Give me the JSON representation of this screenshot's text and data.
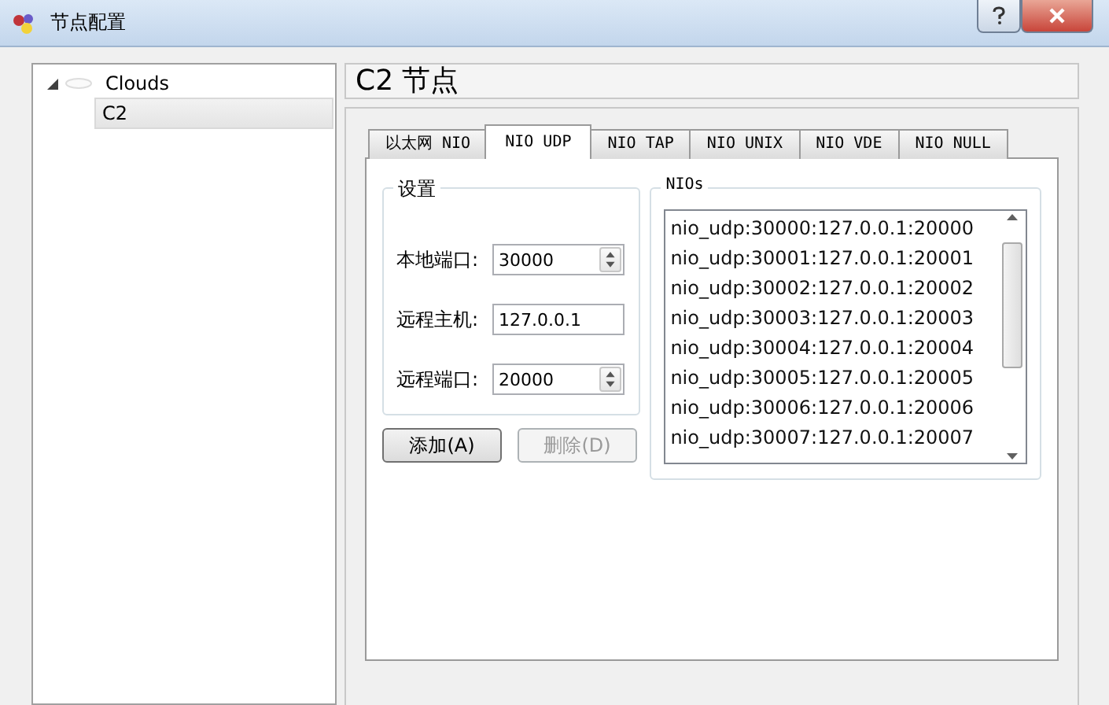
{
  "window": {
    "title": "节点配置"
  },
  "tree": [
    {
      "label": "Clouds",
      "expanded": true,
      "selected": false,
      "children": [
        {
          "label": "C2",
          "selected": true
        }
      ]
    }
  ],
  "header": "C2 节点",
  "tabs": [
    {
      "label": "以太网 NIO",
      "selected": false
    },
    {
      "label": "NIO UDP",
      "selected": true
    },
    {
      "label": "NIO TAP",
      "selected": false
    },
    {
      "label": "NIO UNIX",
      "selected": false
    },
    {
      "label": "NIO VDE",
      "selected": false
    },
    {
      "label": "NIO NULL",
      "selected": false
    }
  ],
  "settings": {
    "title": "设置",
    "fields": [
      {
        "label": "本地端口:",
        "value": "30000",
        "kind": "spin"
      },
      {
        "label": "远程主机:",
        "value": "127.0.0.1",
        "kind": "text"
      },
      {
        "label": "远程端口:",
        "value": "20000",
        "kind": "spin"
      }
    ]
  },
  "buttons": [
    {
      "label": "添加(A)",
      "disabled": false
    },
    {
      "label": "删除(D)",
      "disabled": true
    }
  ],
  "nios": {
    "title": "NIOs",
    "items": [
      "nio_udp:30000:127.0.0.1:20000",
      "nio_udp:30001:127.0.0.1:20001",
      "nio_udp:30002:127.0.0.1:20002",
      "nio_udp:30003:127.0.0.1:20003",
      "nio_udp:30004:127.0.0.1:20004",
      "nio_udp:30005:127.0.0.1:20005",
      "nio_udp:30006:127.0.0.1:20006",
      "nio_udp:30007:127.0.0.1:20007"
    ]
  }
}
